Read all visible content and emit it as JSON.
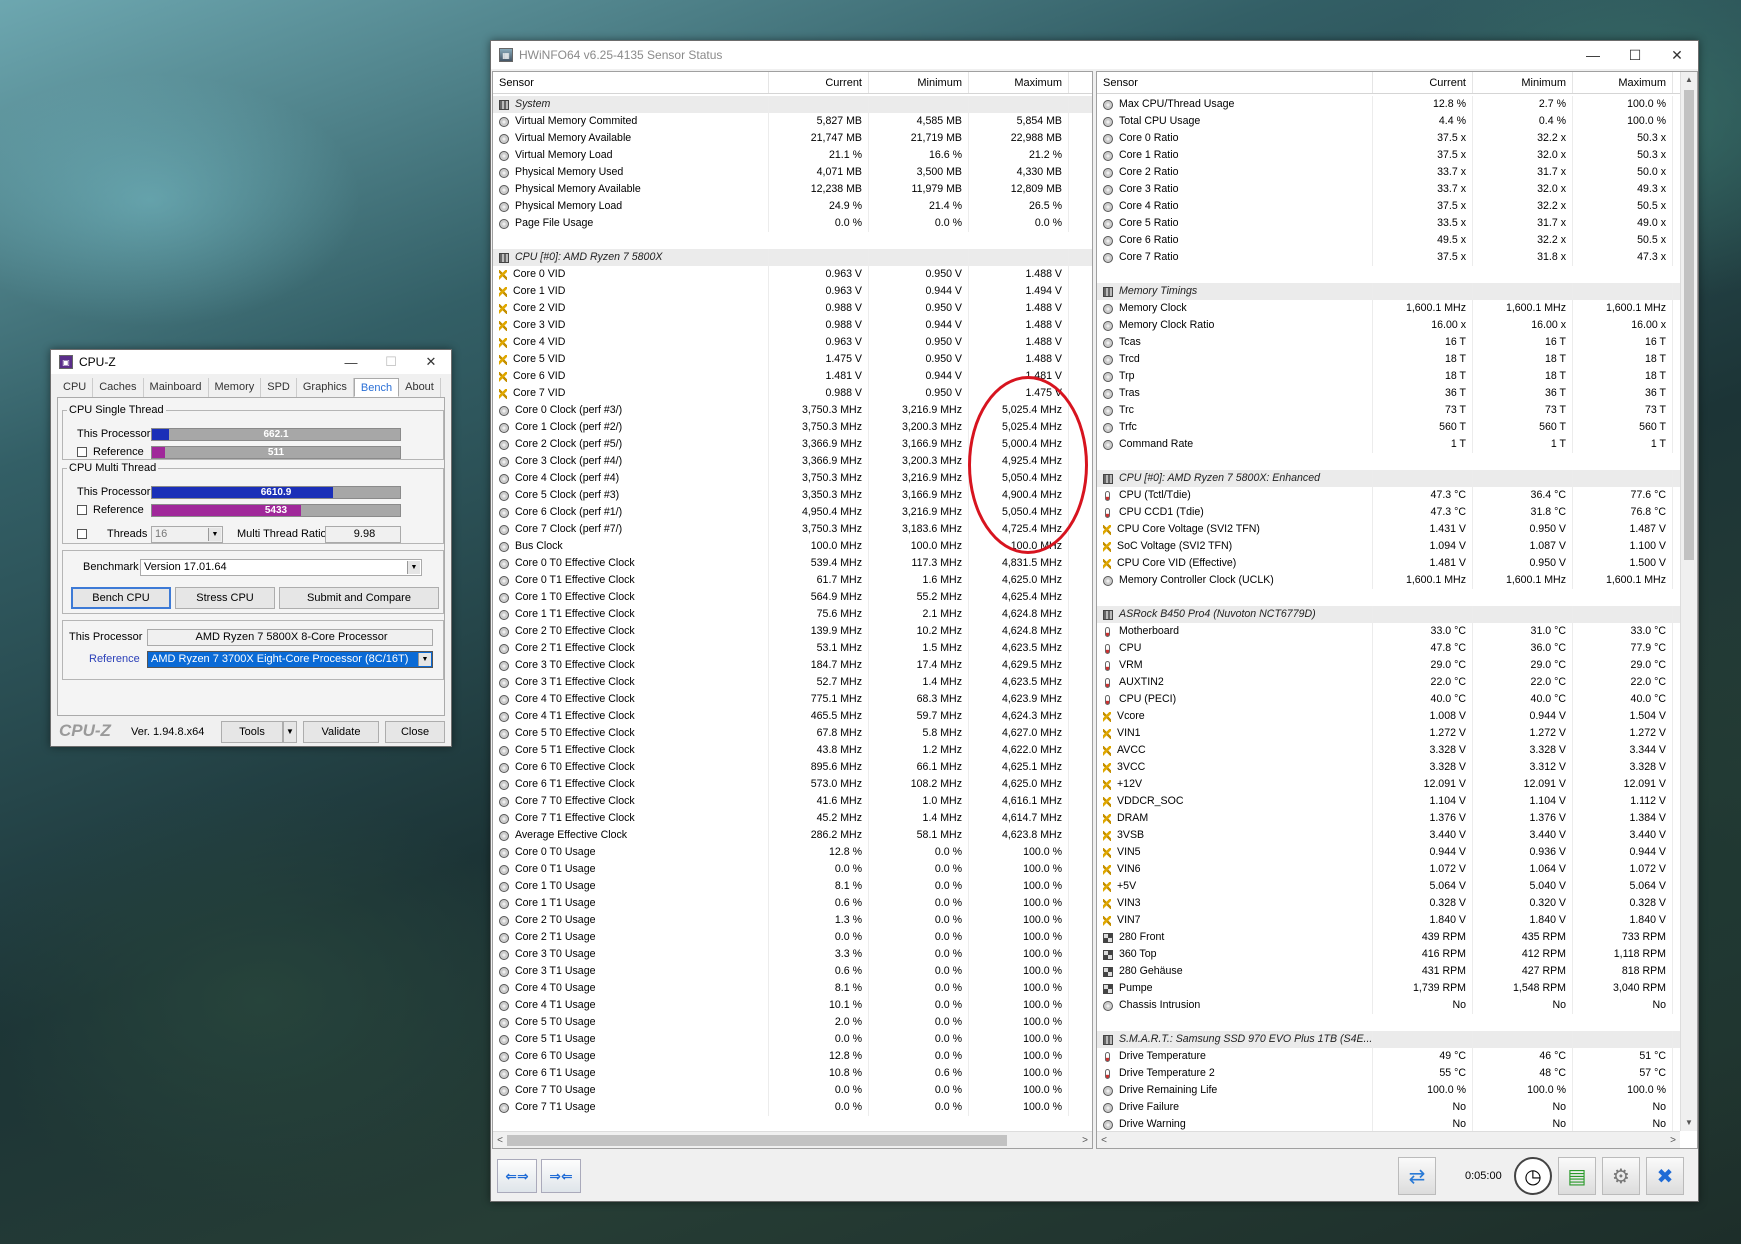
{
  "hwinfo": {
    "title": "HWiNFO64 v6.25-4135 Sensor Status",
    "columns": [
      "Sensor",
      "Current",
      "Minimum",
      "Maximum"
    ],
    "timer": "0:05:00",
    "left_rows": [
      {
        "t": "h",
        "n": "System"
      },
      {
        "i": "clock",
        "n": "Virtual Memory Commited",
        "c": "5,827 MB",
        "mn": "4,585 MB",
        "mx": "5,854 MB"
      },
      {
        "i": "clock",
        "n": "Virtual Memory Available",
        "c": "21,747 MB",
        "mn": "21,719 MB",
        "mx": "22,988 MB"
      },
      {
        "i": "clock",
        "n": "Virtual Memory Load",
        "c": "21.1 %",
        "mn": "16.6 %",
        "mx": "21.2 %"
      },
      {
        "i": "clock",
        "n": "Physical Memory Used",
        "c": "4,071 MB",
        "mn": "3,500 MB",
        "mx": "4,330 MB"
      },
      {
        "i": "clock",
        "n": "Physical Memory Available",
        "c": "12,238 MB",
        "mn": "11,979 MB",
        "mx": "12,809 MB"
      },
      {
        "i": "clock",
        "n": "Physical Memory Load",
        "c": "24.9 %",
        "mn": "21.4 %",
        "mx": "26.5 %"
      },
      {
        "i": "clock",
        "n": "Page File Usage",
        "c": "0.0 %",
        "mn": "0.0 %",
        "mx": "0.0 %"
      },
      {
        "t": "b"
      },
      {
        "t": "h",
        "n": "CPU [#0]: AMD Ryzen 7 5800X"
      },
      {
        "i": "volt",
        "n": "Core 0 VID",
        "c": "0.963 V",
        "mn": "0.950 V",
        "mx": "1.488 V"
      },
      {
        "i": "volt",
        "n": "Core 1 VID",
        "c": "0.963 V",
        "mn": "0.944 V",
        "mx": "1.494 V"
      },
      {
        "i": "volt",
        "n": "Core 2 VID",
        "c": "0.988 V",
        "mn": "0.950 V",
        "mx": "1.488 V"
      },
      {
        "i": "volt",
        "n": "Core 3 VID",
        "c": "0.988 V",
        "mn": "0.944 V",
        "mx": "1.488 V"
      },
      {
        "i": "volt",
        "n": "Core 4 VID",
        "c": "0.963 V",
        "mn": "0.950 V",
        "mx": "1.488 V"
      },
      {
        "i": "volt",
        "n": "Core 5 VID",
        "c": "1.475 V",
        "mn": "0.950 V",
        "mx": "1.488 V"
      },
      {
        "i": "volt",
        "n": "Core 6 VID",
        "c": "1.481 V",
        "mn": "0.944 V",
        "mx": "1.481 V"
      },
      {
        "i": "volt",
        "n": "Core 7 VID",
        "c": "0.988 V",
        "mn": "0.950 V",
        "mx": "1.475 V"
      },
      {
        "i": "clock",
        "n": "Core 0 Clock (perf #3/)",
        "c": "3,750.3 MHz",
        "mn": "3,216.9 MHz",
        "mx": "5,025.4 MHz"
      },
      {
        "i": "clock",
        "n": "Core 1 Clock (perf #2/)",
        "c": "3,750.3 MHz",
        "mn": "3,200.3 MHz",
        "mx": "5,025.4 MHz"
      },
      {
        "i": "clock",
        "n": "Core 2 Clock (perf #5/)",
        "c": "3,366.9 MHz",
        "mn": "3,166.9 MHz",
        "mx": "5,000.4 MHz"
      },
      {
        "i": "clock",
        "n": "Core 3 Clock (perf #4/)",
        "c": "3,366.9 MHz",
        "mn": "3,200.3 MHz",
        "mx": "4,925.4 MHz"
      },
      {
        "i": "clock",
        "n": "Core 4 Clock (perf #4)",
        "c": "3,750.3 MHz",
        "mn": "3,216.9 MHz",
        "mx": "5,050.4 MHz"
      },
      {
        "i": "clock",
        "n": "Core 5 Clock (perf #3)",
        "c": "3,350.3 MHz",
        "mn": "3,166.9 MHz",
        "mx": "4,900.4 MHz"
      },
      {
        "i": "clock",
        "n": "Core 6 Clock (perf #1/)",
        "c": "4,950.4 MHz",
        "mn": "3,216.9 MHz",
        "mx": "5,050.4 MHz"
      },
      {
        "i": "clock",
        "n": "Core 7 Clock (perf #7/)",
        "c": "3,750.3 MHz",
        "mn": "3,183.6 MHz",
        "mx": "4,725.4 MHz"
      },
      {
        "i": "clock",
        "n": "Bus Clock",
        "c": "100.0 MHz",
        "mn": "100.0 MHz",
        "mx": "100.0 MHz"
      },
      {
        "i": "clock",
        "n": "Core 0 T0 Effective Clock",
        "c": "539.4 MHz",
        "mn": "117.3 MHz",
        "mx": "4,831.5 MHz"
      },
      {
        "i": "clock",
        "n": "Core 0 T1 Effective Clock",
        "c": "61.7 MHz",
        "mn": "1.6 MHz",
        "mx": "4,625.0 MHz"
      },
      {
        "i": "clock",
        "n": "Core 1 T0 Effective Clock",
        "c": "564.9 MHz",
        "mn": "55.2 MHz",
        "mx": "4,625.4 MHz"
      },
      {
        "i": "clock",
        "n": "Core 1 T1 Effective Clock",
        "c": "75.6 MHz",
        "mn": "2.1 MHz",
        "mx": "4,624.8 MHz"
      },
      {
        "i": "clock",
        "n": "Core 2 T0 Effective Clock",
        "c": "139.9 MHz",
        "mn": "10.2 MHz",
        "mx": "4,624.8 MHz"
      },
      {
        "i": "clock",
        "n": "Core 2 T1 Effective Clock",
        "c": "53.1 MHz",
        "mn": "1.5 MHz",
        "mx": "4,623.5 MHz"
      },
      {
        "i": "clock",
        "n": "Core 3 T0 Effective Clock",
        "c": "184.7 MHz",
        "mn": "17.4 MHz",
        "mx": "4,629.5 MHz"
      },
      {
        "i": "clock",
        "n": "Core 3 T1 Effective Clock",
        "c": "52.7 MHz",
        "mn": "1.4 MHz",
        "mx": "4,623.5 MHz"
      },
      {
        "i": "clock",
        "n": "Core 4 T0 Effective Clock",
        "c": "775.1 MHz",
        "mn": "68.3 MHz",
        "mx": "4,623.9 MHz"
      },
      {
        "i": "clock",
        "n": "Core 4 T1 Effective Clock",
        "c": "465.5 MHz",
        "mn": "59.7 MHz",
        "mx": "4,624.3 MHz"
      },
      {
        "i": "clock",
        "n": "Core 5 T0 Effective Clock",
        "c": "67.8 MHz",
        "mn": "5.8 MHz",
        "mx": "4,627.0 MHz"
      },
      {
        "i": "clock",
        "n": "Core 5 T1 Effective Clock",
        "c": "43.8 MHz",
        "mn": "1.2 MHz",
        "mx": "4,622.0 MHz"
      },
      {
        "i": "clock",
        "n": "Core 6 T0 Effective Clock",
        "c": "895.6 MHz",
        "mn": "66.1 MHz",
        "mx": "4,625.1 MHz"
      },
      {
        "i": "clock",
        "n": "Core 6 T1 Effective Clock",
        "c": "573.0 MHz",
        "mn": "108.2 MHz",
        "mx": "4,625.0 MHz"
      },
      {
        "i": "clock",
        "n": "Core 7 T0 Effective Clock",
        "c": "41.6 MHz",
        "mn": "1.0 MHz",
        "mx": "4,616.1 MHz"
      },
      {
        "i": "clock",
        "n": "Core 7 T1 Effective Clock",
        "c": "45.2 MHz",
        "mn": "1.4 MHz",
        "mx": "4,614.7 MHz"
      },
      {
        "i": "clock",
        "n": "Average Effective Clock",
        "c": "286.2 MHz",
        "mn": "58.1 MHz",
        "mx": "4,623.8 MHz"
      },
      {
        "i": "clock",
        "n": "Core 0 T0 Usage",
        "c": "12.8 %",
        "mn": "0.0 %",
        "mx": "100.0 %"
      },
      {
        "i": "clock",
        "n": "Core 0 T1 Usage",
        "c": "0.0 %",
        "mn": "0.0 %",
        "mx": "100.0 %"
      },
      {
        "i": "clock",
        "n": "Core 1 T0 Usage",
        "c": "8.1 %",
        "mn": "0.0 %",
        "mx": "100.0 %"
      },
      {
        "i": "clock",
        "n": "Core 1 T1 Usage",
        "c": "0.6 %",
        "mn": "0.0 %",
        "mx": "100.0 %"
      },
      {
        "i": "clock",
        "n": "Core 2 T0 Usage",
        "c": "1.3 %",
        "mn": "0.0 %",
        "mx": "100.0 %"
      },
      {
        "i": "clock",
        "n": "Core 2 T1 Usage",
        "c": "0.0 %",
        "mn": "0.0 %",
        "mx": "100.0 %"
      },
      {
        "i": "clock",
        "n": "Core 3 T0 Usage",
        "c": "3.3 %",
        "mn": "0.0 %",
        "mx": "100.0 %"
      },
      {
        "i": "clock",
        "n": "Core 3 T1 Usage",
        "c": "0.6 %",
        "mn": "0.0 %",
        "mx": "100.0 %"
      },
      {
        "i": "clock",
        "n": "Core 4 T0 Usage",
        "c": "8.1 %",
        "mn": "0.0 %",
        "mx": "100.0 %"
      },
      {
        "i": "clock",
        "n": "Core 4 T1 Usage",
        "c": "10.1 %",
        "mn": "0.0 %",
        "mx": "100.0 %"
      },
      {
        "i": "clock",
        "n": "Core 5 T0 Usage",
        "c": "2.0 %",
        "mn": "0.0 %",
        "mx": "100.0 %"
      },
      {
        "i": "clock",
        "n": "Core 5 T1 Usage",
        "c": "0.0 %",
        "mn": "0.0 %",
        "mx": "100.0 %"
      },
      {
        "i": "clock",
        "n": "Core 6 T0 Usage",
        "c": "12.8 %",
        "mn": "0.0 %",
        "mx": "100.0 %"
      },
      {
        "i": "clock",
        "n": "Core 6 T1 Usage",
        "c": "10.8 %",
        "mn": "0.6 %",
        "mx": "100.0 %"
      },
      {
        "i": "clock",
        "n": "Core 7 T0 Usage",
        "c": "0.0 %",
        "mn": "0.0 %",
        "mx": "100.0 %"
      },
      {
        "i": "clock",
        "n": "Core 7 T1 Usage",
        "c": "0.0 %",
        "mn": "0.0 %",
        "mx": "100.0 %"
      }
    ],
    "right_rows": [
      {
        "i": "clock",
        "n": "Max CPU/Thread Usage",
        "c": "12.8 %",
        "mn": "2.7 %",
        "mx": "100.0 %"
      },
      {
        "i": "clock",
        "n": "Total CPU Usage",
        "c": "4.4 %",
        "mn": "0.4 %",
        "mx": "100.0 %"
      },
      {
        "i": "clock",
        "n": "Core 0 Ratio",
        "c": "37.5 x",
        "mn": "32.2 x",
        "mx": "50.3 x"
      },
      {
        "i": "clock",
        "n": "Core 1 Ratio",
        "c": "37.5 x",
        "mn": "32.0 x",
        "mx": "50.3 x"
      },
      {
        "i": "clock",
        "n": "Core 2 Ratio",
        "c": "33.7 x",
        "mn": "31.7 x",
        "mx": "50.0 x"
      },
      {
        "i": "clock",
        "n": "Core 3 Ratio",
        "c": "33.7 x",
        "mn": "32.0 x",
        "mx": "49.3 x"
      },
      {
        "i": "clock",
        "n": "Core 4 Ratio",
        "c": "37.5 x",
        "mn": "32.2 x",
        "mx": "50.5 x"
      },
      {
        "i": "clock",
        "n": "Core 5 Ratio",
        "c": "33.5 x",
        "mn": "31.7 x",
        "mx": "49.0 x"
      },
      {
        "i": "clock",
        "n": "Core 6 Ratio",
        "c": "49.5 x",
        "mn": "32.2 x",
        "mx": "50.5 x"
      },
      {
        "i": "clock",
        "n": "Core 7 Ratio",
        "c": "37.5 x",
        "mn": "31.8 x",
        "mx": "47.3 x"
      },
      {
        "t": "b"
      },
      {
        "t": "h",
        "n": "Memory Timings"
      },
      {
        "i": "clock",
        "n": "Memory Clock",
        "c": "1,600.1 MHz",
        "mn": "1,600.1 MHz",
        "mx": "1,600.1 MHz"
      },
      {
        "i": "clock",
        "n": "Memory Clock Ratio",
        "c": "16.00 x",
        "mn": "16.00 x",
        "mx": "16.00 x"
      },
      {
        "i": "clock",
        "n": "Tcas",
        "c": "16 T",
        "mn": "16 T",
        "mx": "16 T"
      },
      {
        "i": "clock",
        "n": "Trcd",
        "c": "18 T",
        "mn": "18 T",
        "mx": "18 T"
      },
      {
        "i": "clock",
        "n": "Trp",
        "c": "18 T",
        "mn": "18 T",
        "mx": "18 T"
      },
      {
        "i": "clock",
        "n": "Tras",
        "c": "36 T",
        "mn": "36 T",
        "mx": "36 T"
      },
      {
        "i": "clock",
        "n": "Trc",
        "c": "73 T",
        "mn": "73 T",
        "mx": "73 T"
      },
      {
        "i": "clock",
        "n": "Trfc",
        "c": "560 T",
        "mn": "560 T",
        "mx": "560 T"
      },
      {
        "i": "clock",
        "n": "Command Rate",
        "c": "1 T",
        "mn": "1 T",
        "mx": "1 T"
      },
      {
        "t": "b"
      },
      {
        "t": "h",
        "n": "CPU [#0]: AMD Ryzen 7 5800X: Enhanced"
      },
      {
        "i": "temp",
        "n": "CPU (Tctl/Tdie)",
        "c": "47.3 °C",
        "mn": "36.4 °C",
        "mx": "77.6 °C"
      },
      {
        "i": "temp",
        "n": "CPU CCD1 (Tdie)",
        "c": "47.3 °C",
        "mn": "31.8 °C",
        "mx": "76.8 °C"
      },
      {
        "i": "volt",
        "n": "CPU Core Voltage (SVI2 TFN)",
        "c": "1.431 V",
        "mn": "0.950 V",
        "mx": "1.487 V"
      },
      {
        "i": "volt",
        "n": "SoC Voltage (SVI2 TFN)",
        "c": "1.094 V",
        "mn": "1.087 V",
        "mx": "1.100 V"
      },
      {
        "i": "volt",
        "n": "CPU Core VID (Effective)",
        "c": "1.481 V",
        "mn": "0.950 V",
        "mx": "1.500 V"
      },
      {
        "i": "clock",
        "n": "Memory Controller Clock (UCLK)",
        "c": "1,600.1 MHz",
        "mn": "1,600.1 MHz",
        "mx": "1,600.1 MHz"
      },
      {
        "t": "b"
      },
      {
        "t": "h",
        "n": "ASRock B450 Pro4 (Nuvoton NCT6779D)"
      },
      {
        "i": "temp",
        "n": "Motherboard",
        "c": "33.0 °C",
        "mn": "31.0 °C",
        "mx": "33.0 °C"
      },
      {
        "i": "temp",
        "n": "CPU",
        "c": "47.8 °C",
        "mn": "36.0 °C",
        "mx": "77.9 °C"
      },
      {
        "i": "temp",
        "n": "VRM",
        "c": "29.0 °C",
        "mn": "29.0 °C",
        "mx": "29.0 °C"
      },
      {
        "i": "temp",
        "n": "AUXTIN2",
        "c": "22.0 °C",
        "mn": "22.0 °C",
        "mx": "22.0 °C"
      },
      {
        "i": "temp",
        "n": "CPU (PECI)",
        "c": "40.0 °C",
        "mn": "40.0 °C",
        "mx": "40.0 °C"
      },
      {
        "i": "volt",
        "n": "Vcore",
        "c": "1.008 V",
        "mn": "0.944 V",
        "mx": "1.504 V"
      },
      {
        "i": "volt",
        "n": "VIN1",
        "c": "1.272 V",
        "mn": "1.272 V",
        "mx": "1.272 V"
      },
      {
        "i": "volt",
        "n": "AVCC",
        "c": "3.328 V",
        "mn": "3.328 V",
        "mx": "3.344 V"
      },
      {
        "i": "volt",
        "n": "3VCC",
        "c": "3.328 V",
        "mn": "3.312 V",
        "mx": "3.328 V"
      },
      {
        "i": "volt",
        "n": "+12V",
        "c": "12.091 V",
        "mn": "12.091 V",
        "mx": "12.091 V"
      },
      {
        "i": "volt",
        "n": "VDDCR_SOC",
        "c": "1.104 V",
        "mn": "1.104 V",
        "mx": "1.112 V"
      },
      {
        "i": "volt",
        "n": "DRAM",
        "c": "1.376 V",
        "mn": "1.376 V",
        "mx": "1.384 V"
      },
      {
        "i": "volt",
        "n": "3VSB",
        "c": "3.440 V",
        "mn": "3.440 V",
        "mx": "3.440 V"
      },
      {
        "i": "volt",
        "n": "VIN5",
        "c": "0.944 V",
        "mn": "0.936 V",
        "mx": "0.944 V"
      },
      {
        "i": "volt",
        "n": "VIN6",
        "c": "1.072 V",
        "mn": "1.064 V",
        "mx": "1.072 V"
      },
      {
        "i": "volt",
        "n": "+5V",
        "c": "5.064 V",
        "mn": "5.040 V",
        "mx": "5.064 V"
      },
      {
        "i": "volt",
        "n": "VIN3",
        "c": "0.328 V",
        "mn": "0.320 V",
        "mx": "0.328 V"
      },
      {
        "i": "volt",
        "n": "VIN7",
        "c": "1.840 V",
        "mn": "1.840 V",
        "mx": "1.840 V"
      },
      {
        "i": "fan",
        "n": "280 Front",
        "c": "439 RPM",
        "mn": "435 RPM",
        "mx": "733 RPM"
      },
      {
        "i": "fan",
        "n": "360 Top",
        "c": "416 RPM",
        "mn": "412 RPM",
        "mx": "1,118 RPM"
      },
      {
        "i": "fan",
        "n": "280 Gehäuse",
        "c": "431 RPM",
        "mn": "427 RPM",
        "mx": "818 RPM"
      },
      {
        "i": "fan",
        "n": "Pumpe",
        "c": "1,739 RPM",
        "mn": "1,548 RPM",
        "mx": "3,040 RPM"
      },
      {
        "i": "clock",
        "n": "Chassis Intrusion",
        "c": "No",
        "mn": "No",
        "mx": "No"
      },
      {
        "t": "b"
      },
      {
        "t": "h",
        "n": "S.M.A.R.T.: Samsung SSD 970 EVO Plus 1TB (S4E..."
      },
      {
        "i": "temp",
        "n": "Drive Temperature",
        "c": "49 °C",
        "mn": "46 °C",
        "mx": "51 °C"
      },
      {
        "i": "temp",
        "n": "Drive Temperature 2",
        "c": "55 °C",
        "mn": "48 °C",
        "mx": "57 °C"
      },
      {
        "i": "clock",
        "n": "Drive Remaining Life",
        "c": "100.0 %",
        "mn": "100.0 %",
        "mx": "100.0 %"
      },
      {
        "i": "clock",
        "n": "Drive Failure",
        "c": "No",
        "mn": "No",
        "mx": "No"
      },
      {
        "i": "clock",
        "n": "Drive Warning",
        "c": "No",
        "mn": "No",
        "mx": "No"
      }
    ]
  },
  "cpuz": {
    "title": "CPU-Z",
    "tabs": [
      "CPU",
      "Caches",
      "Mainboard",
      "Memory",
      "SPD",
      "Graphics",
      "Bench",
      "About"
    ],
    "active_tab": "Bench",
    "single_legend": "CPU Single Thread",
    "multi_legend": "CPU Multi Thread",
    "this_processor": "This Processor",
    "reference": "Reference",
    "single_this": "662.1",
    "single_ref": "511",
    "multi_this": "6610.9",
    "multi_ref": "5433",
    "single_this_frac": 0.068,
    "single_ref_frac": 0.052,
    "multi_this_frac": 0.73,
    "multi_ref_frac": 0.6,
    "threads_label": "Threads",
    "threads_value": "16",
    "ratio_label": "Multi Thread Ratio",
    "ratio_value": "9.98",
    "benchmark_label": "Benchmark",
    "benchmark_value": "Version 17.01.64",
    "bench_cpu": "Bench CPU",
    "stress_cpu": "Stress CPU",
    "submit": "Submit and Compare",
    "this_proc_name": "AMD Ryzen 7 5800X 8-Core Processor",
    "ref_proc_name": "AMD Ryzen 7 3700X Eight-Core Processor (8C/16T)",
    "logo": "CPU-Z",
    "version": "Ver. 1.94.8.x64",
    "tools": "Tools",
    "validate": "Validate",
    "close": "Close",
    "colors": {
      "this": "#1a2fb8",
      "ref": "#a0289a"
    }
  }
}
